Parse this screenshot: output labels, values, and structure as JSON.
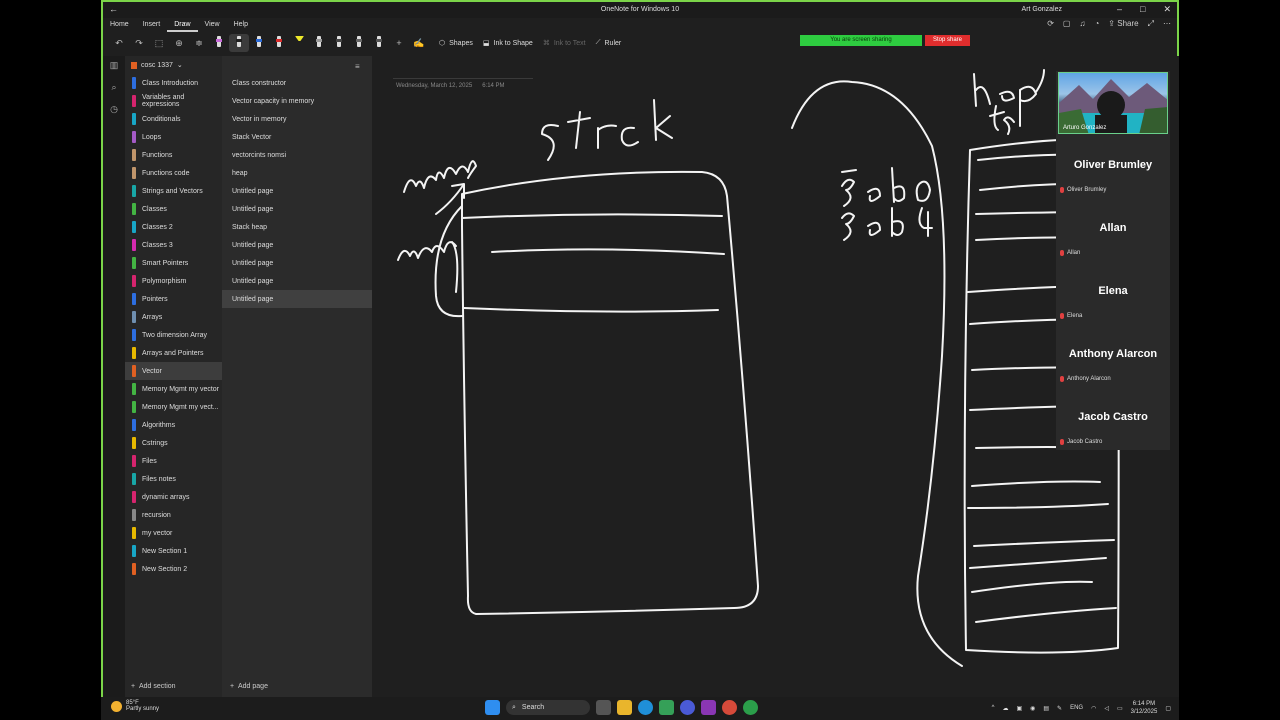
{
  "window": {
    "title": "OneNote for Windows 10",
    "user": "Art Gonzalez"
  },
  "menu": [
    "Home",
    "Insert",
    "Draw",
    "View",
    "Help"
  ],
  "menu_active": "Draw",
  "menu_right": {
    "share": "Share"
  },
  "toolbar": {
    "shapes": "Shapes",
    "ink_to_shape": "Ink to Shape",
    "ink_to_text": "Ink to Text",
    "ruler": "Ruler"
  },
  "sharing": {
    "status": "You are screen sharing",
    "stop": "Stop share"
  },
  "notebook": {
    "name": "cosc 1337"
  },
  "sections": [
    {
      "label": "Class Introduction",
      "color": "#2d6ee0"
    },
    {
      "label": "Variables and expressions",
      "color": "#d6246e"
    },
    {
      "label": "Conditionals",
      "color": "#18a6c6"
    },
    {
      "label": "Loops",
      "color": "#a45ac6"
    },
    {
      "label": "Functions",
      "color": "#c0956b"
    },
    {
      "label": "Functions code",
      "color": "#c0956b"
    },
    {
      "label": "Strings and Vectors",
      "color": "#18a6a6"
    },
    {
      "label": "Classes",
      "color": "#43b443"
    },
    {
      "label": "Classes 2",
      "color": "#18a6c6"
    },
    {
      "label": "Classes 3",
      "color": "#d62ab0"
    },
    {
      "label": "Smart Pointers",
      "color": "#43b443"
    },
    {
      "label": "Polymorphism",
      "color": "#d6246e"
    },
    {
      "label": "Pointers",
      "color": "#2d6ee0"
    },
    {
      "label": "Arrays",
      "color": "#6f8fb0"
    },
    {
      "label": "Two dimension Array",
      "color": "#2d6ee0"
    },
    {
      "label": "Arrays and Pointers",
      "color": "#e6b800"
    },
    {
      "label": "Vector",
      "color": "#e06022"
    },
    {
      "label": "Memory Mgmt my vector",
      "color": "#43b443"
    },
    {
      "label": "Memory Mgmt my vect...",
      "color": "#43b443"
    },
    {
      "label": "Algorithms",
      "color": "#2d6ee0"
    },
    {
      "label": "Cstrings",
      "color": "#e6b800"
    },
    {
      "label": "Files",
      "color": "#d6246e"
    },
    {
      "label": "Files notes",
      "color": "#18a6a6"
    },
    {
      "label": "dynamic arrays",
      "color": "#d6246e"
    },
    {
      "label": "recursion",
      "color": "#888888"
    },
    {
      "label": "my vector",
      "color": "#e6b800"
    },
    {
      "label": "New Section 1",
      "color": "#18a6c6"
    },
    {
      "label": "New Section 2",
      "color": "#e06022"
    }
  ],
  "selected_section": 16,
  "add_section": "Add section",
  "pages": [
    "Class constructor",
    "Vector capacity in memory",
    "Vector in memory",
    "Stack Vector",
    "vectorcints nomsi",
    "heap",
    "Untitled page",
    "Untitled page",
    "Stack heap",
    "Untitled page",
    "Untitled page",
    "Untitled page",
    "Untitled page"
  ],
  "selected_page": 12,
  "add_page": "Add page",
  "page": {
    "date": "Wednesday, March 12, 2025",
    "time": "6:14 PM"
  },
  "video": {
    "self_name": "Arturo Gonzalez",
    "participants": [
      {
        "big": "Oliver Brumley",
        "small": "Oliver Brumley"
      },
      {
        "big": "Allan",
        "small": "Allan"
      },
      {
        "big": "Elena",
        "small": "Elena"
      },
      {
        "big": "Anthony Alarcon",
        "small": "Anthony Alarcon"
      },
      {
        "big": "Jacob Castro",
        "small": "Jacob Castro"
      }
    ]
  },
  "taskbar": {
    "temp": "85°F",
    "weather": "Partly sunny",
    "search": "Search",
    "lang": "ENG",
    "time": "6:14 PM",
    "date": "3/12/2025"
  }
}
